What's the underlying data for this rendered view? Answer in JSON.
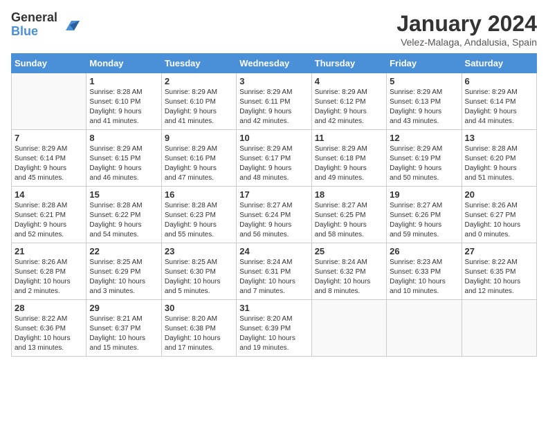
{
  "header": {
    "logo_general": "General",
    "logo_blue": "Blue",
    "month_title": "January 2024",
    "location": "Velez-Malaga, Andalusia, Spain"
  },
  "days_of_week": [
    "Sunday",
    "Monday",
    "Tuesday",
    "Wednesday",
    "Thursday",
    "Friday",
    "Saturday"
  ],
  "weeks": [
    [
      {
        "day": "",
        "info": ""
      },
      {
        "day": "1",
        "info": "Sunrise: 8:28 AM\nSunset: 6:10 PM\nDaylight: 9 hours\nand 41 minutes."
      },
      {
        "day": "2",
        "info": "Sunrise: 8:29 AM\nSunset: 6:10 PM\nDaylight: 9 hours\nand 41 minutes."
      },
      {
        "day": "3",
        "info": "Sunrise: 8:29 AM\nSunset: 6:11 PM\nDaylight: 9 hours\nand 42 minutes."
      },
      {
        "day": "4",
        "info": "Sunrise: 8:29 AM\nSunset: 6:12 PM\nDaylight: 9 hours\nand 42 minutes."
      },
      {
        "day": "5",
        "info": "Sunrise: 8:29 AM\nSunset: 6:13 PM\nDaylight: 9 hours\nand 43 minutes."
      },
      {
        "day": "6",
        "info": "Sunrise: 8:29 AM\nSunset: 6:14 PM\nDaylight: 9 hours\nand 44 minutes."
      }
    ],
    [
      {
        "day": "7",
        "info": "Sunrise: 8:29 AM\nSunset: 6:14 PM\nDaylight: 9 hours\nand 45 minutes."
      },
      {
        "day": "8",
        "info": "Sunrise: 8:29 AM\nSunset: 6:15 PM\nDaylight: 9 hours\nand 46 minutes."
      },
      {
        "day": "9",
        "info": "Sunrise: 8:29 AM\nSunset: 6:16 PM\nDaylight: 9 hours\nand 47 minutes."
      },
      {
        "day": "10",
        "info": "Sunrise: 8:29 AM\nSunset: 6:17 PM\nDaylight: 9 hours\nand 48 minutes."
      },
      {
        "day": "11",
        "info": "Sunrise: 8:29 AM\nSunset: 6:18 PM\nDaylight: 9 hours\nand 49 minutes."
      },
      {
        "day": "12",
        "info": "Sunrise: 8:29 AM\nSunset: 6:19 PM\nDaylight: 9 hours\nand 50 minutes."
      },
      {
        "day": "13",
        "info": "Sunrise: 8:28 AM\nSunset: 6:20 PM\nDaylight: 9 hours\nand 51 minutes."
      }
    ],
    [
      {
        "day": "14",
        "info": "Sunrise: 8:28 AM\nSunset: 6:21 PM\nDaylight: 9 hours\nand 52 minutes."
      },
      {
        "day": "15",
        "info": "Sunrise: 8:28 AM\nSunset: 6:22 PM\nDaylight: 9 hours\nand 54 minutes."
      },
      {
        "day": "16",
        "info": "Sunrise: 8:28 AM\nSunset: 6:23 PM\nDaylight: 9 hours\nand 55 minutes."
      },
      {
        "day": "17",
        "info": "Sunrise: 8:27 AM\nSunset: 6:24 PM\nDaylight: 9 hours\nand 56 minutes."
      },
      {
        "day": "18",
        "info": "Sunrise: 8:27 AM\nSunset: 6:25 PM\nDaylight: 9 hours\nand 58 minutes."
      },
      {
        "day": "19",
        "info": "Sunrise: 8:27 AM\nSunset: 6:26 PM\nDaylight: 9 hours\nand 59 minutes."
      },
      {
        "day": "20",
        "info": "Sunrise: 8:26 AM\nSunset: 6:27 PM\nDaylight: 10 hours\nand 0 minutes."
      }
    ],
    [
      {
        "day": "21",
        "info": "Sunrise: 8:26 AM\nSunset: 6:28 PM\nDaylight: 10 hours\nand 2 minutes."
      },
      {
        "day": "22",
        "info": "Sunrise: 8:25 AM\nSunset: 6:29 PM\nDaylight: 10 hours\nand 3 minutes."
      },
      {
        "day": "23",
        "info": "Sunrise: 8:25 AM\nSunset: 6:30 PM\nDaylight: 10 hours\nand 5 minutes."
      },
      {
        "day": "24",
        "info": "Sunrise: 8:24 AM\nSunset: 6:31 PM\nDaylight: 10 hours\nand 7 minutes."
      },
      {
        "day": "25",
        "info": "Sunrise: 8:24 AM\nSunset: 6:32 PM\nDaylight: 10 hours\nand 8 minutes."
      },
      {
        "day": "26",
        "info": "Sunrise: 8:23 AM\nSunset: 6:33 PM\nDaylight: 10 hours\nand 10 minutes."
      },
      {
        "day": "27",
        "info": "Sunrise: 8:22 AM\nSunset: 6:35 PM\nDaylight: 10 hours\nand 12 minutes."
      }
    ],
    [
      {
        "day": "28",
        "info": "Sunrise: 8:22 AM\nSunset: 6:36 PM\nDaylight: 10 hours\nand 13 minutes."
      },
      {
        "day": "29",
        "info": "Sunrise: 8:21 AM\nSunset: 6:37 PM\nDaylight: 10 hours\nand 15 minutes."
      },
      {
        "day": "30",
        "info": "Sunrise: 8:20 AM\nSunset: 6:38 PM\nDaylight: 10 hours\nand 17 minutes."
      },
      {
        "day": "31",
        "info": "Sunrise: 8:20 AM\nSunset: 6:39 PM\nDaylight: 10 hours\nand 19 minutes."
      },
      {
        "day": "",
        "info": ""
      },
      {
        "day": "",
        "info": ""
      },
      {
        "day": "",
        "info": ""
      }
    ]
  ]
}
